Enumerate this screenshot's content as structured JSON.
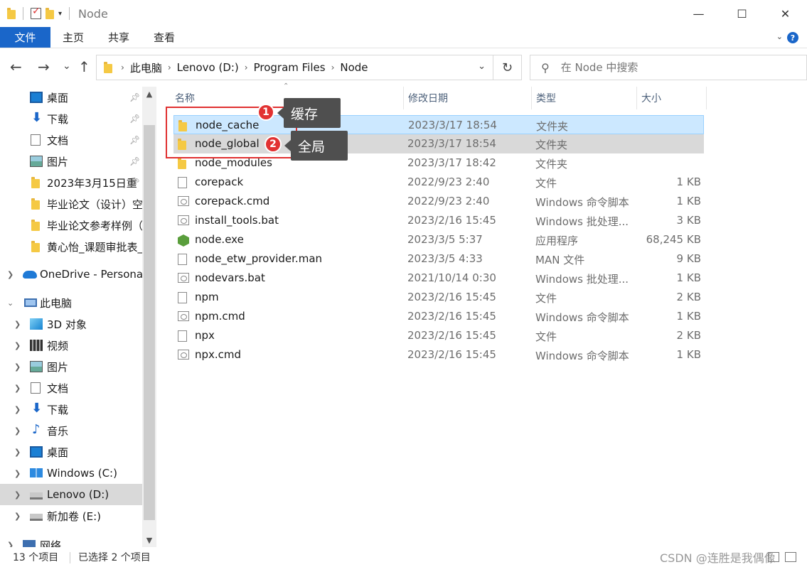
{
  "window": {
    "title": "Node",
    "controls": {
      "minimize": "—",
      "maximize": "☐",
      "close": "✕"
    }
  },
  "ribbon": {
    "tabs": [
      "文件",
      "主页",
      "共享",
      "查看"
    ],
    "help": "?"
  },
  "nav": {
    "back": "←",
    "forward": "→",
    "recent": "⌄",
    "up": "↑",
    "breadcrumb": [
      "此电脑",
      "Lenovo (D:)",
      "Program Files",
      "Node"
    ],
    "refresh": "↻",
    "search_placeholder": "在 Node 中搜索"
  },
  "sidebar": {
    "items": [
      {
        "label": "桌面",
        "icon": "desktop-icon",
        "pinned": true
      },
      {
        "label": "下载",
        "icon": "download-icon",
        "pinned": true
      },
      {
        "label": "文档",
        "icon": "document-icon",
        "pinned": true
      },
      {
        "label": "图片",
        "icon": "picture-icon",
        "pinned": true
      },
      {
        "label": "2023年3月15日重",
        "icon": "folder-icon",
        "pinned": true
      },
      {
        "label": "毕业论文（设计）空",
        "icon": "folder-icon"
      },
      {
        "label": "毕业论文参考样例（",
        "icon": "folder-icon"
      },
      {
        "label": "黄心怡_课题审批表_",
        "icon": "folder-icon"
      },
      {
        "label": "OneDrive - Personal",
        "icon": "onedrive-icon"
      },
      {
        "label": "此电脑",
        "icon": "this-pc-icon"
      },
      {
        "label": "3D 对象",
        "icon": "3d-objects-icon"
      },
      {
        "label": "视频",
        "icon": "video-icon"
      },
      {
        "label": "图片",
        "icon": "picture-icon"
      },
      {
        "label": "文档",
        "icon": "document-icon"
      },
      {
        "label": "下载",
        "icon": "download-icon"
      },
      {
        "label": "音乐",
        "icon": "music-icon"
      },
      {
        "label": "桌面",
        "icon": "desktop-icon"
      },
      {
        "label": "Windows (C:)",
        "icon": "windows-drive-icon"
      },
      {
        "label": "Lenovo (D:)",
        "icon": "drive-icon",
        "selected": true
      },
      {
        "label": "新加卷 (E:)",
        "icon": "drive-icon"
      },
      {
        "label": "网络",
        "icon": "network-icon"
      }
    ]
  },
  "columns": {
    "name": "名称",
    "date": "修改日期",
    "type": "类型",
    "size": "大小"
  },
  "files": [
    {
      "name": "node_cache",
      "date": "2023/3/17 18:54",
      "type": "文件夹",
      "size": "",
      "icon": "folder-icon"
    },
    {
      "name": "node_global",
      "date": "2023/3/17 18:54",
      "type": "文件夹",
      "size": "",
      "icon": "folder-icon"
    },
    {
      "name": "node_modules",
      "date": "2023/3/17 18:42",
      "type": "文件夹",
      "size": "",
      "icon": "folder-icon"
    },
    {
      "name": "corepack",
      "date": "2022/9/23 2:40",
      "type": "文件",
      "size": "1 KB",
      "icon": "file-icon"
    },
    {
      "name": "corepack.cmd",
      "date": "2022/9/23 2:40",
      "type": "Windows 命令脚本",
      "size": "1 KB",
      "icon": "script-icon"
    },
    {
      "name": "install_tools.bat",
      "date": "2023/2/16 15:45",
      "type": "Windows 批处理...",
      "size": "3 KB",
      "icon": "script-icon"
    },
    {
      "name": "node.exe",
      "date": "2023/3/5 5:37",
      "type": "应用程序",
      "size": "68,245 KB",
      "icon": "node-exe-icon"
    },
    {
      "name": "node_etw_provider.man",
      "date": "2023/3/5 4:33",
      "type": "MAN 文件",
      "size": "9 KB",
      "icon": "file-icon"
    },
    {
      "name": "nodevars.bat",
      "date": "2021/10/14 0:30",
      "type": "Windows 批处理...",
      "size": "1 KB",
      "icon": "script-icon"
    },
    {
      "name": "npm",
      "date": "2023/2/16 15:45",
      "type": "文件",
      "size": "2 KB",
      "icon": "file-icon"
    },
    {
      "name": "npm.cmd",
      "date": "2023/2/16 15:45",
      "type": "Windows 命令脚本",
      "size": "1 KB",
      "icon": "script-icon"
    },
    {
      "name": "npx",
      "date": "2023/2/16 15:45",
      "type": "文件",
      "size": "2 KB",
      "icon": "file-icon"
    },
    {
      "name": "npx.cmd",
      "date": "2023/2/16 15:45",
      "type": "Windows 命令脚本",
      "size": "1 KB",
      "icon": "script-icon"
    }
  ],
  "annotations": [
    {
      "number": "1",
      "text": "缓存"
    },
    {
      "number": "2",
      "text": "全局"
    }
  ],
  "status": {
    "count": "13 个项目",
    "selected": "已选择 2 个项目",
    "watermark": "CSDN @连胜是我偶像"
  },
  "colors": {
    "accent": "#1a66c9",
    "selection": "#cce8ff",
    "annotation_red": "#e23232"
  }
}
